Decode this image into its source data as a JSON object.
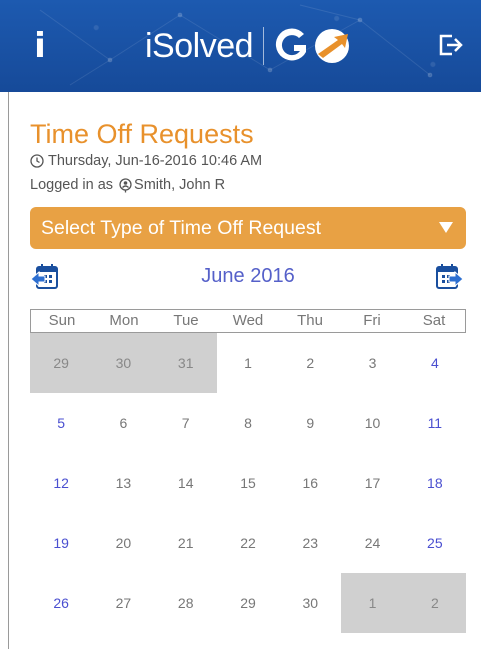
{
  "header": {
    "info_label": "i",
    "brand_name": "iSolved",
    "brand_go": "GO",
    "colors": {
      "bar": "#1a4f9e",
      "go_arrow": "#e8912c"
    },
    "icons": {
      "info": "info-icon",
      "logout": "logout-icon"
    }
  },
  "page": {
    "title": "Time Off Requests",
    "datetime": "Thursday, Jun-16-2016 10:46 AM",
    "logged_in_prefix": "Logged in as",
    "user_name": "Smith, John R"
  },
  "request_type": {
    "selected": "Select Type of Time Off Request",
    "color": "#e8a144"
  },
  "calendar": {
    "month_label": "June 2016",
    "weekdays": [
      "Sun",
      "Mon",
      "Tue",
      "Wed",
      "Thu",
      "Fri",
      "Sat"
    ],
    "weeks": [
      [
        {
          "d": "29",
          "other": true
        },
        {
          "d": "30",
          "other": true
        },
        {
          "d": "31",
          "other": true
        },
        {
          "d": "1"
        },
        {
          "d": "2"
        },
        {
          "d": "3"
        },
        {
          "d": "4"
        }
      ],
      [
        {
          "d": "5"
        },
        {
          "d": "6"
        },
        {
          "d": "7"
        },
        {
          "d": "8"
        },
        {
          "d": "9"
        },
        {
          "d": "10"
        },
        {
          "d": "11"
        }
      ],
      [
        {
          "d": "12"
        },
        {
          "d": "13"
        },
        {
          "d": "14"
        },
        {
          "d": "15"
        },
        {
          "d": "16"
        },
        {
          "d": "17"
        },
        {
          "d": "18"
        }
      ],
      [
        {
          "d": "19"
        },
        {
          "d": "20"
        },
        {
          "d": "21"
        },
        {
          "d": "22"
        },
        {
          "d": "23"
        },
        {
          "d": "24"
        },
        {
          "d": "25"
        }
      ],
      [
        {
          "d": "26"
        },
        {
          "d": "27"
        },
        {
          "d": "28"
        },
        {
          "d": "29"
        },
        {
          "d": "30"
        },
        {
          "d": "1",
          "other": true
        },
        {
          "d": "2",
          "other": true
        }
      ]
    ],
    "colors": {
      "weekend": "#4a4fd0",
      "month": "#5560c9",
      "other_month_bg": "#d0d0d0"
    }
  }
}
